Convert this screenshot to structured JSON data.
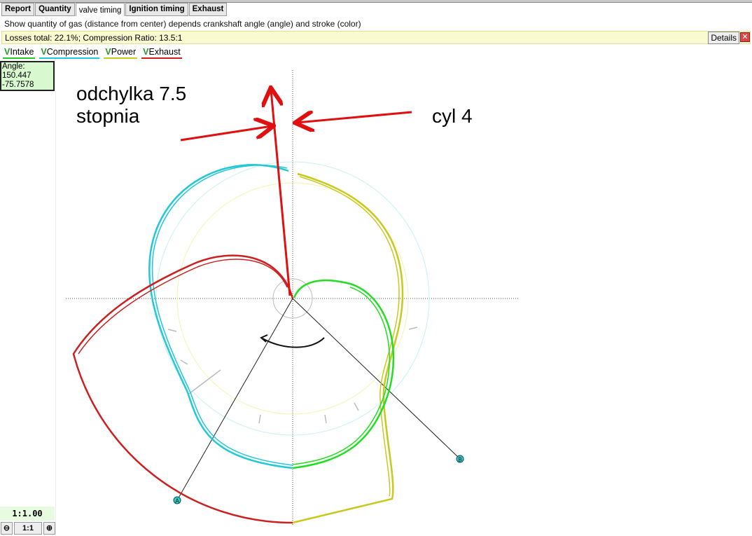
{
  "tabs": [
    "Report",
    "Quantity",
    "valve timing",
    "Ignition timing",
    "Exhaust"
  ],
  "description": "Show quantity of gas (distance from center) depends crankshaft angle (angle) and stroke (color)",
  "losses": "Losses total: 22.1%;   Compression Ratio: 13.5:1",
  "details_label": "Details",
  "close_label": "✕",
  "checks": [
    {
      "label": "Intake",
      "color": "#22cc22"
    },
    {
      "label": "Compression",
      "color": "#22c8d8"
    },
    {
      "label": "Power",
      "color": "#c8c820"
    },
    {
      "label": "Exhaust",
      "color": "#cc2020"
    }
  ],
  "check_mark": "V",
  "angle": {
    "label": "Angle:",
    "v1": "150.447",
    "v2": "-75.7578"
  },
  "zoom": {
    "level": "1:1.00",
    "minus": "⊖",
    "reset": "1:1",
    "plus": "⊕"
  },
  "annotations": {
    "line1": "odchylka 7.5",
    "line2": "stopnia",
    "cyl": "cyl 4"
  },
  "markers": {
    "a": "A",
    "b": "B"
  }
}
